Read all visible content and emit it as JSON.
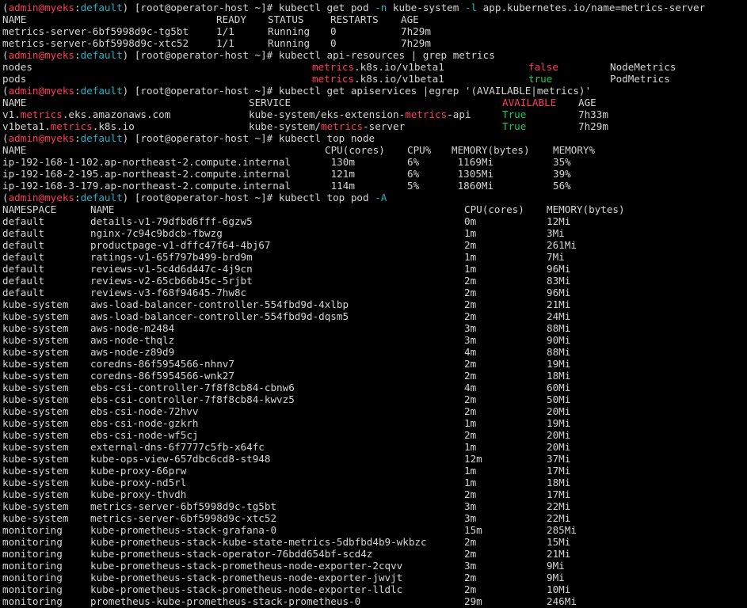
{
  "colors": {
    "background": "#000000",
    "text": "#d4d4d4",
    "prompt_user": "#ff3b5c",
    "prompt_namespace": "#1fb5c8",
    "highlight": "#ff3b5c",
    "true": "#23c55e",
    "false": "#ff3b5c"
  },
  "prompt": {
    "open": "(",
    "user": "admin@myeks",
    "sep": ":",
    "namespace": "default",
    "close": ")",
    "host": " [root@operator-host ~]# "
  },
  "commands": {
    "get_pod": [
      "kubectl get pod ",
      "-n",
      " kube-system ",
      "-l",
      " app.kubernetes.io/name=metrics-server"
    ],
    "api_resources": "kubectl api-resources | grep metrics",
    "apiservices": "kubectl get apiservices |egrep '(AVAILABLE|metrics)'",
    "top_node": "kubectl top node",
    "top_pod": [
      "kubectl top pod ",
      "-A"
    ]
  },
  "pods": {
    "headers": [
      "NAME",
      "READY",
      "STATUS",
      "RESTARTS",
      "AGE"
    ],
    "rows": [
      [
        "metrics-server-6bf5998d9c-tg5bt",
        "1/1",
        "Running",
        "0",
        "7h29m"
      ],
      [
        "metrics-server-6bf5998d9c-xtc52",
        "1/1",
        "Running",
        "0",
        "7h29m"
      ]
    ]
  },
  "api_resources": {
    "rows": [
      {
        "name": "nodes",
        "group_hl": "metrics",
        "group_rest": ".k8s.io/v1beta1",
        "namespaced": "false",
        "kind": "NodeMetrics"
      },
      {
        "name": "pods",
        "group_hl": "metrics",
        "group_rest": ".k8s.io/v1beta1",
        "namespaced": "true",
        "kind": "PodMetrics"
      }
    ]
  },
  "apiservices": {
    "headers": [
      "NAME",
      "SERVICE",
      "AVAILABLE",
      "AGE"
    ],
    "rows": [
      {
        "name_pre": "v1.",
        "name_hl": "metrics",
        "name_post": ".eks.amazonaws.com",
        "svc_pre": "kube-system/eks-extension-",
        "svc_hl": "metrics",
        "svc_post": "-api",
        "available": "True",
        "age": "7h33m"
      },
      {
        "name_pre": "v1beta1.",
        "name_hl": "metrics",
        "name_post": ".k8s.io",
        "svc_pre": "kube-system/",
        "svc_hl": "metrics",
        "svc_post": "-server",
        "available": "True",
        "age": "7h29m"
      }
    ]
  },
  "top_node": {
    "headers": [
      "NAME",
      "CPU(cores)",
      "CPU%",
      "MEMORY(bytes)",
      "MEMORY%"
    ],
    "rows": [
      [
        "ip-192-168-1-102.ap-northeast-2.compute.internal",
        "130m",
        "6%",
        "1169Mi",
        "35%"
      ],
      [
        "ip-192-168-2-195.ap-northeast-2.compute.internal",
        "121m",
        "6%",
        "1305Mi",
        "39%"
      ],
      [
        "ip-192-168-3-179.ap-northeast-2.compute.internal",
        "114m",
        "5%",
        "1860Mi",
        "56%"
      ]
    ]
  },
  "top_pod": {
    "headers": [
      "NAMESPACE",
      "NAME",
      "CPU(cores)",
      "MEMORY(bytes)"
    ],
    "rows": [
      [
        "default",
        "details-v1-79dfbd6fff-6gzw5",
        "0m",
        "12Mi"
      ],
      [
        "default",
        "nginx-7c94c9bdcb-fbwzg",
        "1m",
        "3Mi"
      ],
      [
        "default",
        "productpage-v1-dffc47f64-4bj67",
        "2m",
        "261Mi"
      ],
      [
        "default",
        "ratings-v1-65f797b499-brd9m",
        "1m",
        "7Mi"
      ],
      [
        "default",
        "reviews-v1-5c4d6d447c-4j9cn",
        "1m",
        "96Mi"
      ],
      [
        "default",
        "reviews-v2-65cb66b45c-5rjbt",
        "2m",
        "83Mi"
      ],
      [
        "default",
        "reviews-v3-f68f94645-7hw8c",
        "2m",
        "96Mi"
      ],
      [
        "kube-system",
        "aws-load-balancer-controller-554fbd9d-4xlbp",
        "2m",
        "21Mi"
      ],
      [
        "kube-system",
        "aws-load-balancer-controller-554fbd9d-dqsm5",
        "2m",
        "24Mi"
      ],
      [
        "kube-system",
        "aws-node-m2484",
        "3m",
        "88Mi"
      ],
      [
        "kube-system",
        "aws-node-thqlz",
        "3m",
        "90Mi"
      ],
      [
        "kube-system",
        "aws-node-z89d9",
        "4m",
        "88Mi"
      ],
      [
        "kube-system",
        "coredns-86f5954566-nhnv7",
        "2m",
        "19Mi"
      ],
      [
        "kube-system",
        "coredns-86f5954566-wnk27",
        "2m",
        "18Mi"
      ],
      [
        "kube-system",
        "ebs-csi-controller-7f8f8cb84-cbnw6",
        "4m",
        "60Mi"
      ],
      [
        "kube-system",
        "ebs-csi-controller-7f8f8cb84-kwvz5",
        "2m",
        "50Mi"
      ],
      [
        "kube-system",
        "ebs-csi-node-72hvv",
        "2m",
        "20Mi"
      ],
      [
        "kube-system",
        "ebs-csi-node-gzkrh",
        "1m",
        "19Mi"
      ],
      [
        "kube-system",
        "ebs-csi-node-wf5cj",
        "2m",
        "20Mi"
      ],
      [
        "kube-system",
        "external-dns-6f7777c5fb-x64fc",
        "1m",
        "20Mi"
      ],
      [
        "kube-system",
        "kube-ops-view-657dbc6cd8-st948",
        "12m",
        "37Mi"
      ],
      [
        "kube-system",
        "kube-proxy-66prw",
        "1m",
        "17Mi"
      ],
      [
        "kube-system",
        "kube-proxy-nd5rl",
        "1m",
        "18Mi"
      ],
      [
        "kube-system",
        "kube-proxy-thvdh",
        "2m",
        "17Mi"
      ],
      [
        "kube-system",
        "metrics-server-6bf5998d9c-tg5bt",
        "3m",
        "22Mi"
      ],
      [
        "kube-system",
        "metrics-server-6bf5998d9c-xtc52",
        "3m",
        "22Mi"
      ],
      [
        "monitoring",
        "kube-prometheus-stack-grafana-0",
        "15m",
        "285Mi"
      ],
      [
        "monitoring",
        "kube-prometheus-stack-kube-state-metrics-5dbfbd4b9-wkbzc",
        "2m",
        "15Mi"
      ],
      [
        "monitoring",
        "kube-prometheus-stack-operator-76bdd654bf-scd4z",
        "2m",
        "21Mi"
      ],
      [
        "monitoring",
        "kube-prometheus-stack-prometheus-node-exporter-2cqvv",
        "3m",
        "9Mi"
      ],
      [
        "monitoring",
        "kube-prometheus-stack-prometheus-node-exporter-jwvjt",
        "2m",
        "9Mi"
      ],
      [
        "monitoring",
        "kube-prometheus-stack-prometheus-node-exporter-lldlc",
        "2m",
        "10Mi"
      ],
      [
        "monitoring",
        "prometheus-kube-prometheus-stack-prometheus-0",
        "29m",
        "246Mi"
      ]
    ]
  }
}
